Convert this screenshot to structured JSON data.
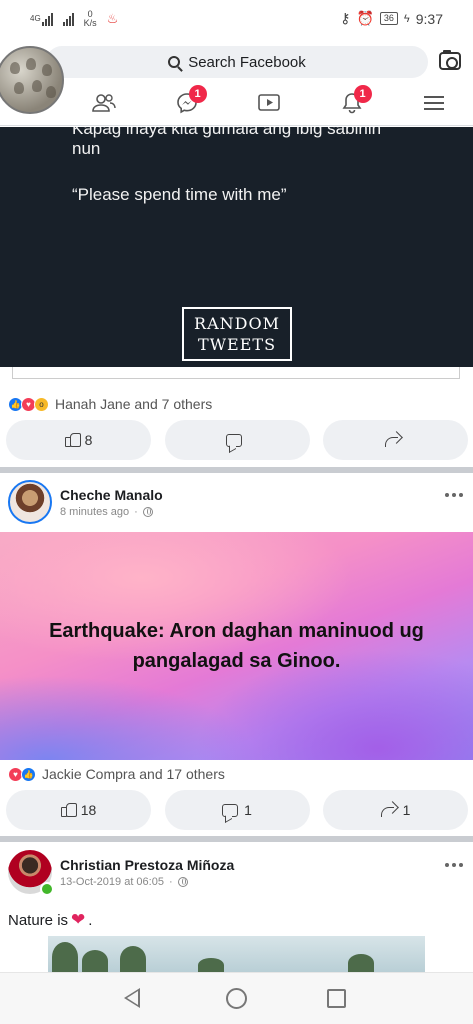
{
  "status_bar": {
    "network_1": "4G",
    "speed_value": "0",
    "speed_unit": "K/s",
    "battery": "36",
    "time": "9:37"
  },
  "header": {
    "search_placeholder": "Search Facebook",
    "nav": [
      {
        "name": "friends",
        "badge": ""
      },
      {
        "name": "messenger",
        "badge": "1"
      },
      {
        "name": "watch",
        "badge": ""
      },
      {
        "name": "notifications",
        "badge": "1"
      },
      {
        "name": "menu",
        "badge": ""
      }
    ]
  },
  "post1": {
    "image_text_line1": "Kapag inaya kita gumala ang ibig sabihin",
    "image_text_line2": "nun",
    "image_text_quote": "“Please spend time with me”",
    "logo_line1": "RANDOM",
    "logo_line2": "TWEETS",
    "reactions_text": "Hanah Jane and 7 others",
    "like_count": "8",
    "comment_count": "",
    "share_count": ""
  },
  "post2": {
    "author": "Cheche Manalo",
    "time": "8 minutes ago",
    "content": "Earthquake: Aron daghan maninuod ug pangalagad sa Ginoo.",
    "reactions_text": "Jackie Compra and 17 others",
    "like_count": "18",
    "comment_count": "1",
    "share_count": "1"
  },
  "post3": {
    "author": "Christian Prestoza Miñoza",
    "time": "13-Oct-2019 at 06:05",
    "text": "Nature is",
    "text_suffix": "."
  },
  "colors": {
    "accent": "#1877f2",
    "badge": "#f02849",
    "tweet_bg": "#182029"
  }
}
